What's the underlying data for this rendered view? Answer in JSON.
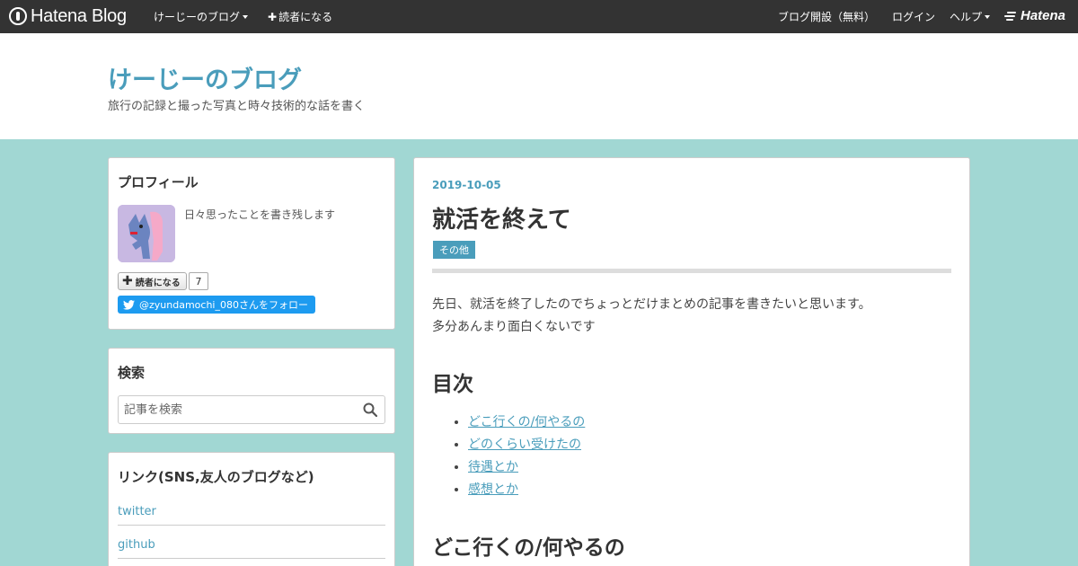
{
  "topbar": {
    "logo_text": "Hatena Blog",
    "my_blog": "けーじーのブログ",
    "subscribe": "読者になる",
    "open_blog": "ブログ開設（無料）",
    "login": "ログイン",
    "help": "ヘルプ",
    "brand": "Hatena"
  },
  "header": {
    "title": "けーじーのブログ",
    "description": "旅行の記録と撮った写真と時々技術的な話を書く"
  },
  "sidebar": {
    "profile": {
      "title": "プロフィール",
      "text": "日々思ったことを書き残します",
      "subscribe_label": "読者になる",
      "subscriber_count": "7",
      "twitter_follow": "@zyundamochi_080さんをフォロー"
    },
    "search": {
      "title": "検索",
      "placeholder": "記事を検索"
    },
    "links": {
      "title": "リンク(SNS,友人のブログなど)",
      "items": [
        "twitter",
        "github",
        ""
      ]
    }
  },
  "entry": {
    "date": "2019-10-05",
    "title": "就活を終えて",
    "category": "その他",
    "paragraph_1": "先日、就活を終了したのでちょっとだけまとめの記事を書きたいと思います。",
    "paragraph_2": "多分あんまり面白くないです",
    "toc_heading": "目次",
    "toc": [
      "どこ行くの/何やるの",
      "どのくらい受けたの",
      "待遇とか",
      "感想とか"
    ],
    "section_heading": "どこ行くの/何やるの"
  },
  "colors": {
    "background": "#a1d7d3",
    "accent": "#4a9dbb",
    "topbar": "#333333",
    "twitter": "#1d9bf0"
  },
  "icons": [
    "hatena-blog-logo-icon",
    "plus-icon",
    "twitter-bird-icon",
    "search-icon",
    "hatena-logo-icon"
  ]
}
